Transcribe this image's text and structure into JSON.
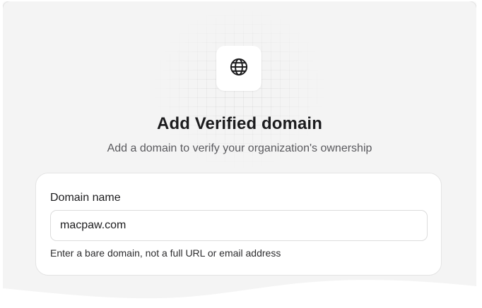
{
  "dialog": {
    "icon": "globe-icon",
    "title": "Add Verified domain",
    "subtitle": "Add a domain to verify your organization's ownership"
  },
  "form": {
    "domain_label": "Domain name",
    "domain_value": "macpaw.com",
    "domain_hint": "Enter a bare domain, not a full URL or email address"
  },
  "colors": {
    "sheet_background": "#f4f4f4",
    "card_background": "#ffffff",
    "title_text": "#1c1c1e",
    "subtitle_text": "#5a5a5e"
  }
}
